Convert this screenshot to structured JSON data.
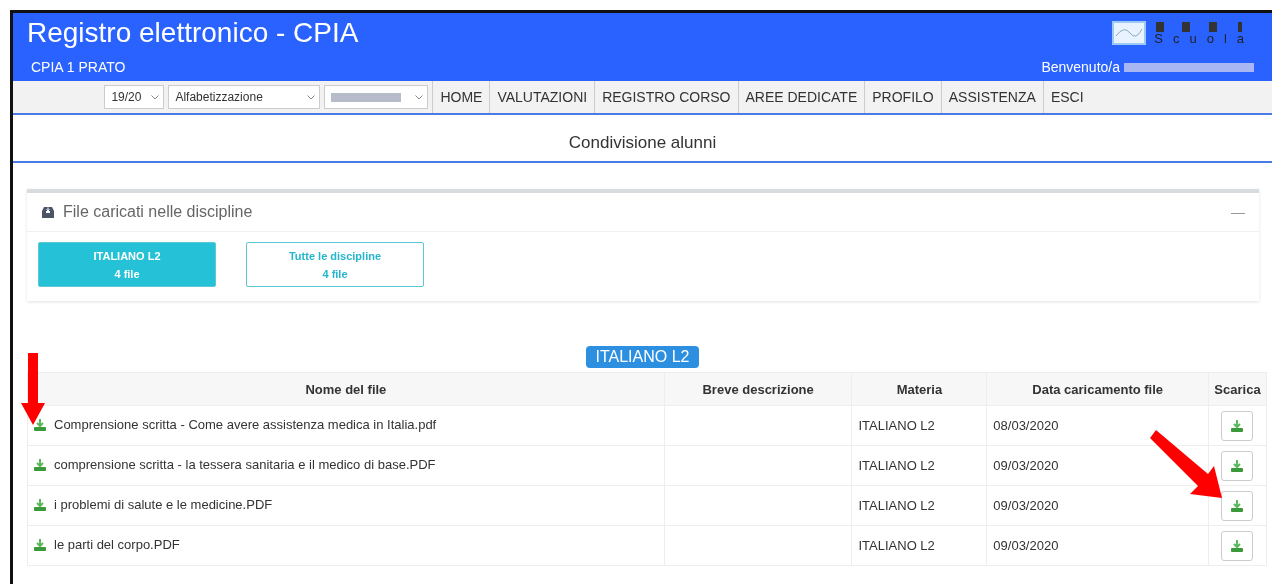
{
  "header": {
    "title": "Registro elettronico - CPIA",
    "school": "CPIA 1 PRATO",
    "logo_text": "Scuola",
    "welcome": "Benvenuto/a"
  },
  "nav": {
    "selects": [
      {
        "kind": "text",
        "value": "19/20"
      },
      {
        "kind": "text",
        "value": "Alfabetizzazione"
      },
      {
        "kind": "redacted"
      }
    ],
    "items": [
      "HOME",
      "VALUTAZIONI",
      "REGISTRO CORSO",
      "AREE DEDICATE",
      "PROFILO",
      "ASSISTENZA",
      "ESCI"
    ]
  },
  "page_title": "Condivisione alunni",
  "panel": {
    "title": "File caricati nelle discipline",
    "collapse": "—",
    "filters": [
      {
        "label": "ITALIANO L2",
        "count": "4 file",
        "selected": true
      },
      {
        "label": "Tutte le discipline",
        "count": "4 file",
        "selected": false
      }
    ]
  },
  "section_badge": "ITALIANO L2",
  "table": {
    "columns": [
      "Nome del file",
      "Breve descrizione",
      "Materia",
      "Data caricamento file",
      "Scarica"
    ],
    "rows": [
      {
        "name": "Comprensione scritta - Come avere assistenza medica in Italia.pdf",
        "subject": "ITALIANO L2",
        "date": "08/03/2020"
      },
      {
        "name": "comprensione scritta - la tessera sanitaria e il medico di base.PDF",
        "subject": "ITALIANO L2",
        "date": "09/03/2020"
      },
      {
        "name": "i problemi di salute e le medicine.PDF",
        "subject": "ITALIANO L2",
        "date": "09/03/2020"
      },
      {
        "name": "le parti del corpo.PDF",
        "subject": "ITALIANO L2",
        "date": "09/03/2020"
      }
    ]
  }
}
